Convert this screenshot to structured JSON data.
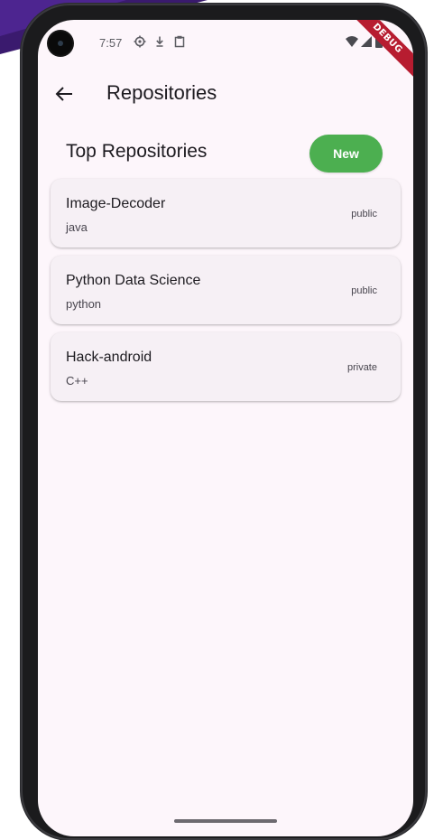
{
  "status_bar": {
    "time": "7:57"
  },
  "debug_banner": "DEBUG",
  "app_bar": {
    "title": "Repositories"
  },
  "section": {
    "title": "Top Repositories",
    "new_button_label": "New"
  },
  "repositories": [
    {
      "name": "Image-Decoder",
      "language": "java",
      "visibility": "public"
    },
    {
      "name": "Python Data Science",
      "language": "python",
      "visibility": "public"
    },
    {
      "name": "Hack-android",
      "language": "C++",
      "visibility": "private"
    }
  ],
  "colors": {
    "new_button": "#4caf50",
    "screen_background": "#fdf6fb",
    "card_background": "#f6f0f5",
    "debug_ribbon": "#b71c30"
  },
  "icons": {
    "back": "arrow-back-icon",
    "settings": "gear-icon",
    "download": "download-icon",
    "clipboard": "clipboard-icon",
    "wifi": "wifi-icon",
    "signal": "cell-signal-icon",
    "battery": "battery-icon"
  }
}
